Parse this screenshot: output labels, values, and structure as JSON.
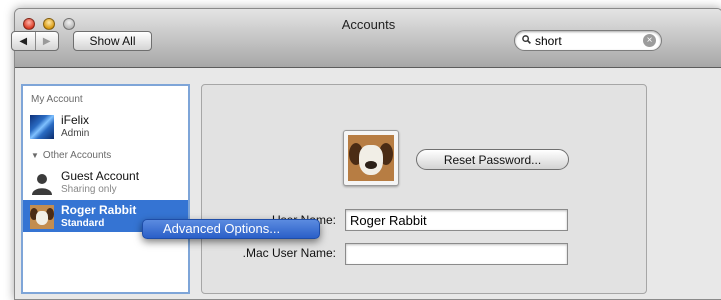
{
  "window": {
    "title": "Accounts"
  },
  "toolbar": {
    "back_icon": "◀",
    "forward_icon": "▶",
    "show_all_label": "Show All",
    "search_value": "short",
    "search_clear_icon": "×"
  },
  "sidebar": {
    "my_account_header": "My Account",
    "other_accounts_header": "Other Accounts",
    "disclosure_icon": "▼",
    "accounts": [
      {
        "name": "iFelix",
        "role": "Admin"
      },
      {
        "name": "Guest Account",
        "role": "Sharing only"
      },
      {
        "name": "Roger Rabbit",
        "role": "Standard"
      }
    ]
  },
  "context_menu": {
    "advanced_options_label": "Advanced Options..."
  },
  "content": {
    "reset_password_label": "Reset Password...",
    "user_name_label": "User Name:",
    "user_name_value": "Roger Rabbit",
    "mac_user_name_label": ".Mac User Name:",
    "mac_user_name_value": ""
  },
  "colors": {
    "selection": "#3574d3",
    "sidebar_border": "#7ea5d8",
    "menu_highlight": "#2a5fc8"
  }
}
